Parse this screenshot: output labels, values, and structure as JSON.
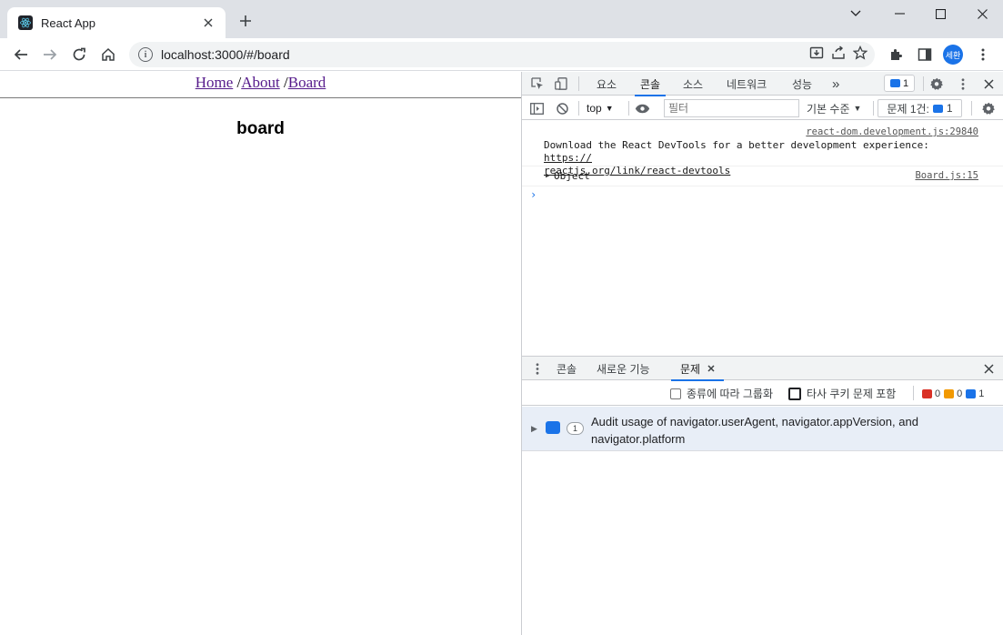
{
  "browser": {
    "tab_title": "React App",
    "url": "localhost:3000/#/board",
    "profile_initials": "세환"
  },
  "page": {
    "nav": [
      {
        "label": "Home"
      },
      {
        "sep": " /"
      },
      {
        "label": "About"
      },
      {
        "sep": " /"
      },
      {
        "label": "Board"
      }
    ],
    "heading": "board"
  },
  "devtools": {
    "tabs": [
      "요소",
      "콘솔",
      "소스",
      "네트워크",
      "성능"
    ],
    "active_tab": "콘솔",
    "more_glyph": "»",
    "message_count": "1",
    "context": "top",
    "filter_placeholder": "필터",
    "level": "기본 수준",
    "issues_label": "문제 1건:",
    "issues_count": "1",
    "logs": [
      {
        "source": "react-dom.development.js:29840",
        "text": "Download the React DevTools for a better development experience: ",
        "link_part1": "https://",
        "link_part2": "reactjs.org/link/react-devtools"
      },
      {
        "source": "Board.js:15",
        "text": "Object"
      }
    ],
    "prompt": "›",
    "drawer": {
      "tabs": [
        "콘솔",
        "새로운 기능",
        "문제"
      ],
      "active_tab": "문제",
      "group_by_kind": "종류에 따라 그룹화",
      "third_party": "타사 쿠키 문제 포함",
      "error_count": "0",
      "warning_count": "0",
      "info_count": "1",
      "colors": {
        "error": "#d93025",
        "warning": "#f29900",
        "info": "#1a73e8"
      },
      "issue": {
        "count": "1",
        "text": "Audit usage of navigator.userAgent, navigator.appVersion, and navigator.platform"
      }
    }
  }
}
